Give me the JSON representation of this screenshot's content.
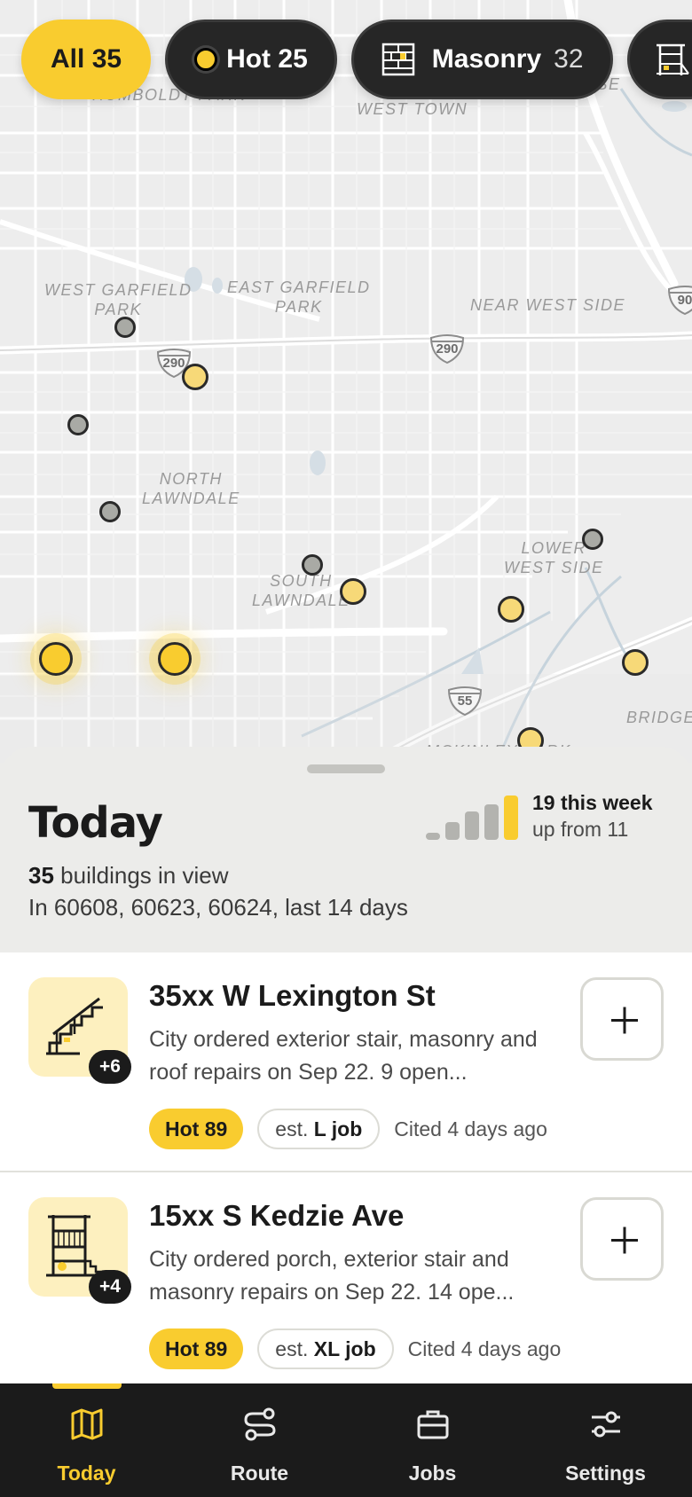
{
  "filters": [
    {
      "label": "All",
      "count": "35",
      "active": true
    },
    {
      "label": "Hot",
      "count": "25",
      "active": false
    },
    {
      "label": "Masonry",
      "count": "32",
      "active": false
    },
    {
      "label": "",
      "count": "",
      "active": false,
      "icon": "scaffold-icon"
    }
  ],
  "map": {
    "area_labels": [
      "HUMBOLDT PARK",
      "WEST TOWN",
      "WEST GARFIELD\nPARK",
      "EAST GARFIELD\nPARK",
      "NEAR WEST SIDE",
      "NORTH\nLAWNDALE",
      "SOUTH\nLAWNDALE",
      "LOWER\nWEST SIDE",
      "BRIDGE",
      "OSE",
      "MCKINLEY PARK"
    ],
    "highway_shields": [
      "290",
      "290",
      "90",
      "55"
    ]
  },
  "sheet": {
    "title": "Today",
    "week_count": "19 this week",
    "week_compare": "up from 11",
    "buildings_count": "35",
    "buildings_label": "buildings in view",
    "scope": "In 60608, 60623, 60624, last 14 days"
  },
  "cards": [
    {
      "address": "35xx W Lexington St",
      "description": "City ordered exterior stair, masonry and roof repairs on Sep 22. 9 open...",
      "extra": "+6",
      "hot": "Hot 89",
      "est_prefix": "est.",
      "est_size": "L job",
      "cited": "Cited 4 days ago",
      "icon": "stair-icon"
    },
    {
      "address": "15xx S Kedzie Ave",
      "description": "City ordered porch, exterior stair and masonry repairs on Sep 22. 14 ope...",
      "extra": "+4",
      "hot": "Hot 89",
      "est_prefix": "est.",
      "est_size": "XL job",
      "cited": "Cited 4 days ago",
      "icon": "porch-icon"
    }
  ],
  "nav": [
    {
      "label": "Today",
      "icon": "map-icon",
      "active": true
    },
    {
      "label": "Route",
      "icon": "route-icon",
      "active": false
    },
    {
      "label": "Jobs",
      "icon": "briefcase-icon",
      "active": false
    },
    {
      "label": "Settings",
      "icon": "sliders-icon",
      "active": false
    }
  ],
  "colors": {
    "accent": "#f9cc2f",
    "dark": "#1b1b1b",
    "sheet_bg": "#ececea"
  }
}
